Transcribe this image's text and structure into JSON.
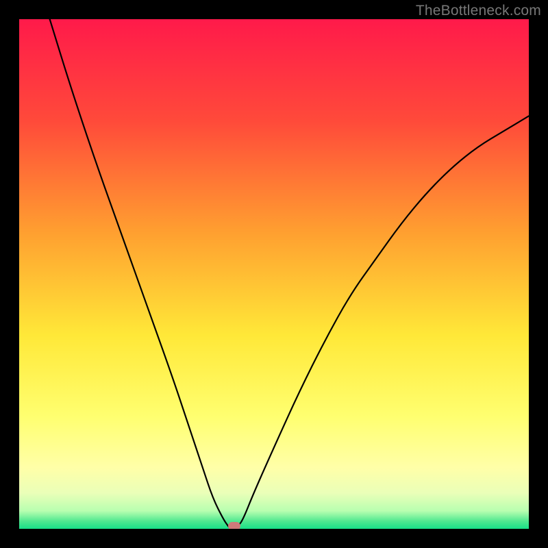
{
  "watermark": "TheBottleneck.com",
  "colors": {
    "frame": "#000000",
    "curve": "#000000",
    "marker": "#cf7a7a",
    "gradient_stops": [
      {
        "pct": 0,
        "color": "#ff1a4a"
      },
      {
        "pct": 20,
        "color": "#ff4a3a"
      },
      {
        "pct": 42,
        "color": "#ffa030"
      },
      {
        "pct": 62,
        "color": "#ffe838"
      },
      {
        "pct": 78,
        "color": "#ffff70"
      },
      {
        "pct": 88,
        "color": "#ffffa8"
      },
      {
        "pct": 93,
        "color": "#eaffb8"
      },
      {
        "pct": 96.5,
        "color": "#b8ffb0"
      },
      {
        "pct": 98.5,
        "color": "#50e890"
      },
      {
        "pct": 100,
        "color": "#18df88"
      }
    ]
  },
  "chart_data": {
    "type": "line",
    "title": "",
    "xlabel": "",
    "ylabel": "",
    "xlim": [
      0,
      100
    ],
    "ylim": [
      0,
      100
    ],
    "grid": false,
    "legend": false,
    "description": "V-shaped bottleneck curve with a single sharp minimum near the bottom axis; background gradient red (top) through orange/yellow to green (bottom).",
    "series": [
      {
        "name": "bottleneck-curve",
        "x": [
          6,
          10,
          15,
          20,
          25,
          30,
          33,
          36,
          38,
          40,
          41,
          41.5,
          43,
          44,
          46,
          50,
          55,
          60,
          65,
          70,
          75,
          80,
          85,
          90,
          95,
          100
        ],
        "y": [
          100,
          87,
          72,
          58,
          44,
          30,
          21,
          12,
          6,
          2,
          0.5,
          0,
          0.5,
          2,
          7,
          16,
          27,
          37,
          46,
          53,
          60,
          66,
          71,
          75,
          78,
          81
        ]
      }
    ],
    "marker": {
      "x": 42.2,
      "y": 0
    }
  }
}
